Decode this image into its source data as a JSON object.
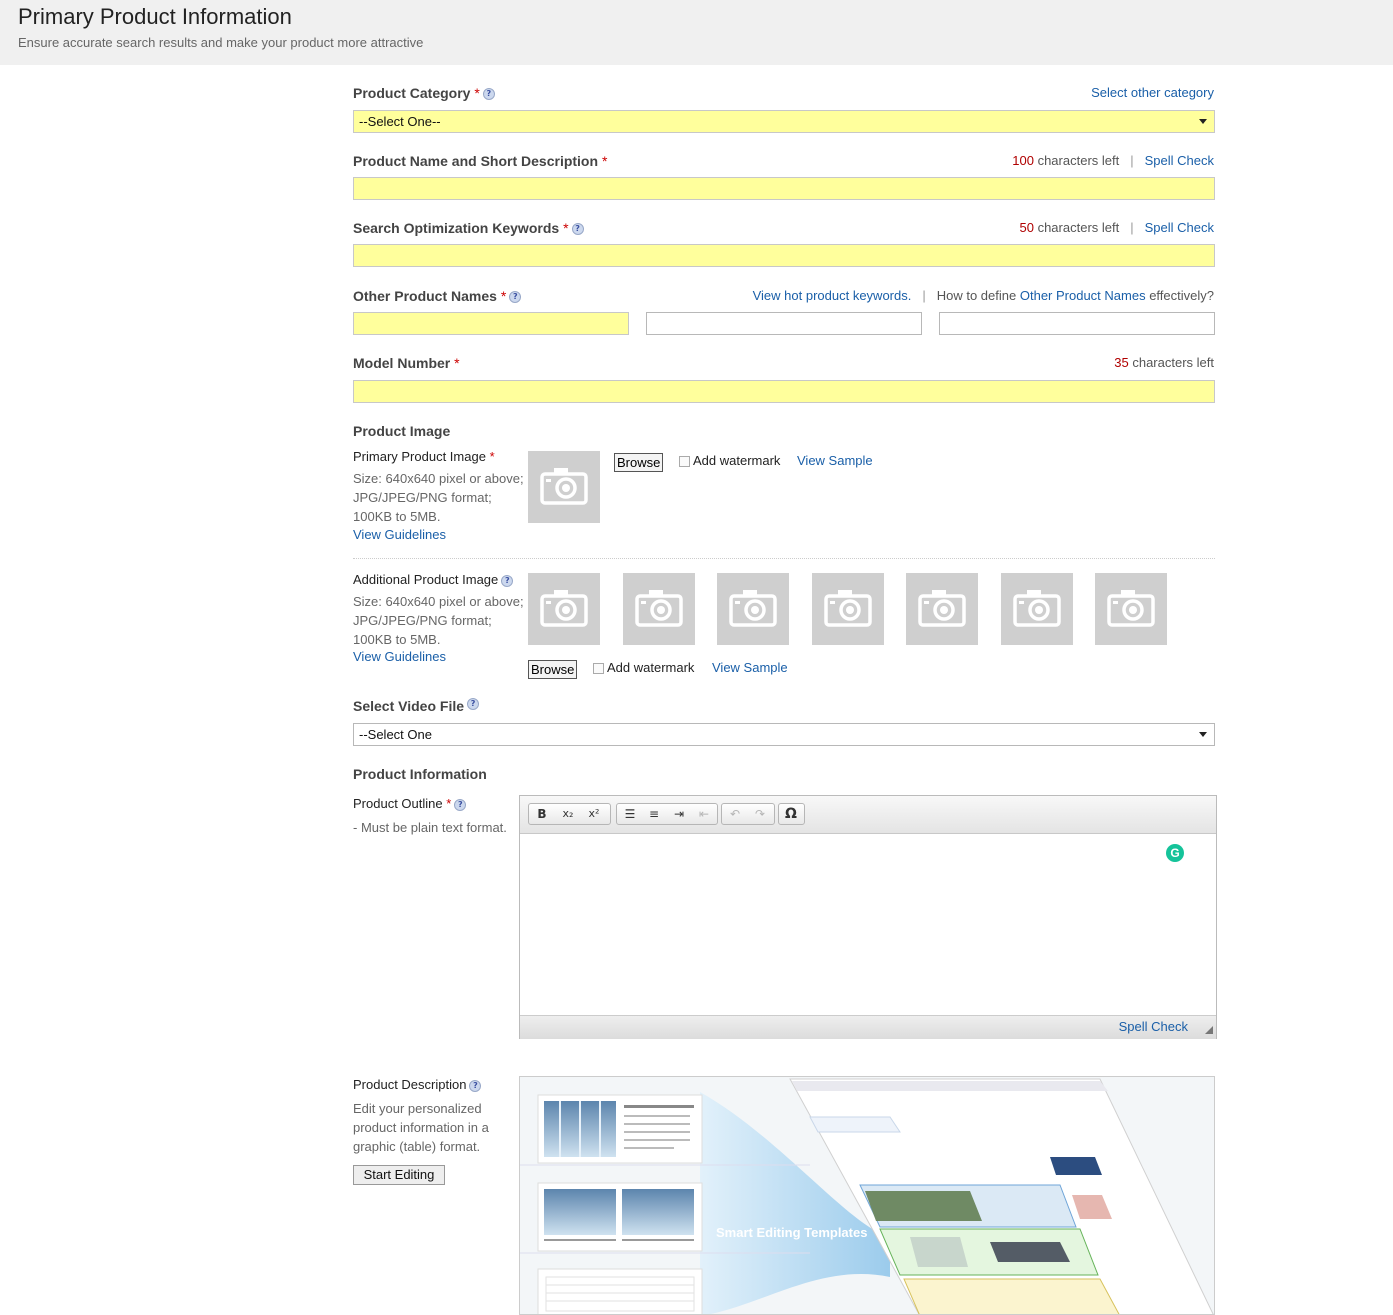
{
  "header": {
    "title": "Primary Product Information",
    "subtitle": "Ensure accurate search results and make your product more attractive"
  },
  "required_mark": "*",
  "help_glyph": "?",
  "separator": "|",
  "chars_left_text": "characters left",
  "spell_check_label": "Spell Check",
  "category": {
    "label": "Product Category",
    "select_other_link": "Select other category",
    "selected": "--Select One--"
  },
  "product_name": {
    "label": "Product Name and Short Description",
    "chars_left": "100"
  },
  "keywords": {
    "label": "Search Optimization Keywords",
    "chars_left": "50"
  },
  "other_names": {
    "label": "Other Product Names",
    "hot_keywords_link": "View hot product keywords.",
    "how_to_prefix": "How to define",
    "how_to_link": "Other Product Names",
    "how_to_suffix": "effectively?"
  },
  "model_number": {
    "label": "Model Number",
    "chars_left": "35"
  },
  "product_image": {
    "section_label": "Product Image",
    "primary": {
      "label": "Primary Product Image",
      "size": "Size: 640x640 pixel or above;",
      "format": "JPG/JPEG/PNG format;",
      "filesize": "100KB to 5MB.",
      "guidelines_link": "View Guidelines"
    },
    "additional": {
      "label": "Additional Product Image",
      "size": "Size: 640x640 pixel or above;",
      "format": "JPG/JPEG/PNG format;",
      "filesize": "100KB to 5MB.",
      "guidelines_link": "View Guidelines"
    },
    "browse_label": "Browse",
    "watermark_label": "Add watermark",
    "view_sample_link": "View Sample"
  },
  "video": {
    "label": "Select Video File",
    "selected": "--Select One"
  },
  "product_info": {
    "section_label": "Product Information",
    "outline_label": "Product Outline",
    "outline_note": "- Must be plain text format.",
    "toolbar": {
      "bold": "B",
      "subscript": "x₂",
      "superscript": "x²",
      "omega": "Ω"
    },
    "grammarly_glyph": "G"
  },
  "description": {
    "label": "Product Description",
    "line1": "Edit your personalized",
    "line2": "product information in a",
    "line3": "graphic (table) format.",
    "start_button": "Start Editing",
    "banner_text": "Smart Editing Templates"
  }
}
